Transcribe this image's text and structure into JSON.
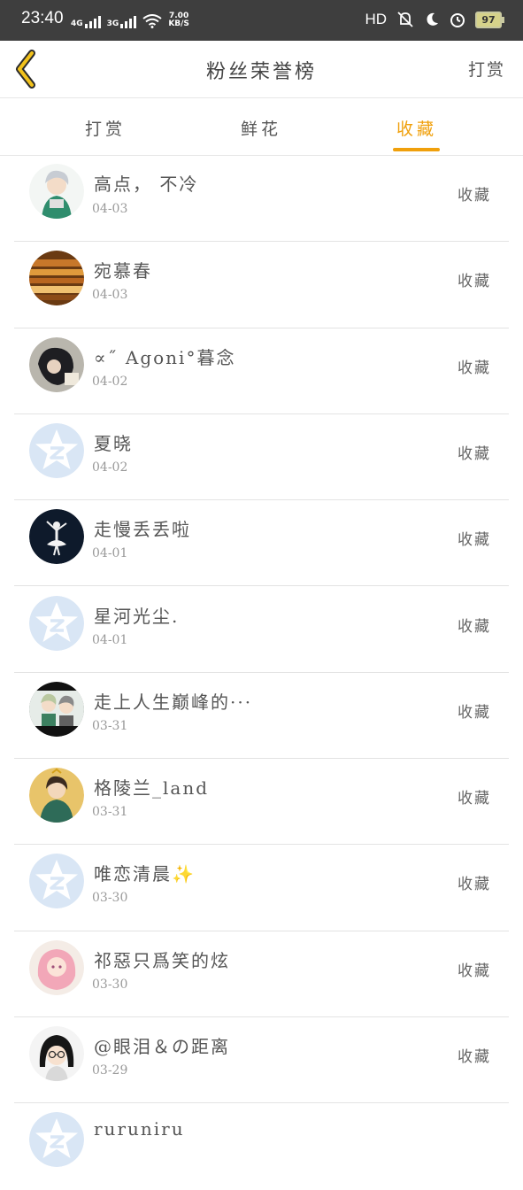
{
  "status_bar": {
    "time": "23:40",
    "net1": "4G",
    "net2": "3G",
    "speed_value": "7.00",
    "speed_unit": "KB/S",
    "hd": "HD",
    "battery": "97"
  },
  "nav": {
    "title": "粉丝荣誉榜",
    "action_label": "打赏"
  },
  "tabs": [
    {
      "label": "打赏"
    },
    {
      "label": "鲜花"
    },
    {
      "label": "收藏"
    }
  ],
  "active_tab": "收藏",
  "colors": {
    "accent": "#f0a00c",
    "status_bar_bg": "#3e3e3e",
    "text": "#555555",
    "date": "#999999",
    "divider": "#e3e3e3"
  },
  "list": {
    "tag_label": "收藏",
    "items": [
      {
        "name": "高点， 不冷",
        "date": "04-03",
        "avatar": "anime-boy-green"
      },
      {
        "name": "宛慕春",
        "date": "04-03",
        "avatar": "wooden-dock"
      },
      {
        "name": "∝˝ Agoni°暮念",
        "date": "04-02",
        "avatar": "dark-photo"
      },
      {
        "name": "夏晓",
        "date": "04-02",
        "avatar": "default-star"
      },
      {
        "name": "走慢丢丢啦",
        "date": "04-01",
        "avatar": "ballerina-dark"
      },
      {
        "name": "星河光尘.",
        "date": "04-01",
        "avatar": "default-star"
      },
      {
        "name": "走上人生巅峰的···",
        "date": "03-31",
        "avatar": "anime-duo"
      },
      {
        "name": "格陵兰_land",
        "date": "03-31",
        "avatar": "anime-warrior"
      },
      {
        "name": "唯恋清晨✨",
        "date": "03-30",
        "avatar": "default-star"
      },
      {
        "name": "祁惡只爲笑的炫",
        "date": "03-30",
        "avatar": "pink-anime-girl"
      },
      {
        "name": "@眼泪＆の距离",
        "date": "03-29",
        "avatar": "glasses-girl"
      },
      {
        "name": "ruruniru",
        "date": "",
        "avatar": "default-star"
      }
    ]
  }
}
